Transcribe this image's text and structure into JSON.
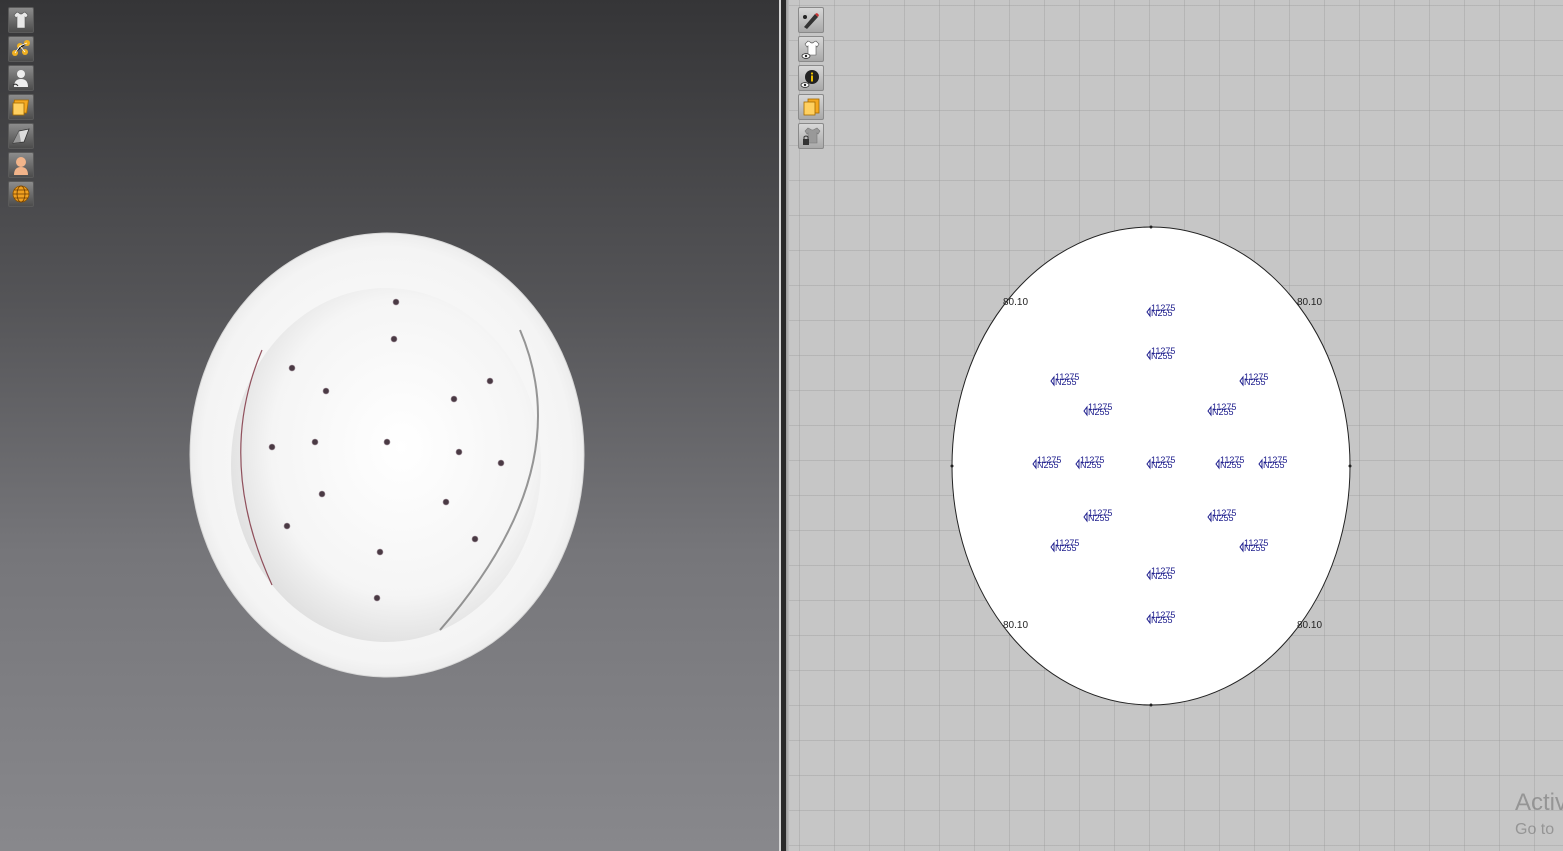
{
  "toolbar3d": {
    "tools": [
      {
        "name": "garment-icon"
      },
      {
        "name": "points-icon"
      },
      {
        "name": "avatar-icon"
      },
      {
        "name": "texture-icon"
      },
      {
        "name": "shading-icon"
      },
      {
        "name": "skin-icon"
      },
      {
        "name": "globe-icon"
      }
    ]
  },
  "toolbar2d": {
    "tools": [
      {
        "name": "pen-icon"
      },
      {
        "name": "show-garment-icon"
      },
      {
        "name": "info-icon"
      },
      {
        "name": "texture-icon"
      },
      {
        "name": "locked-garment-icon"
      }
    ]
  },
  "pattern": {
    "segment_length": "80.10",
    "hole_label_top": "11275",
    "hole_label_bottom": "N255"
  },
  "watermark": {
    "title": "Activ",
    "subtitle": "Go to"
  },
  "colors": {
    "label_blue": "#1c1c8c",
    "outline": "#222222",
    "hole": "#4a3a44"
  }
}
